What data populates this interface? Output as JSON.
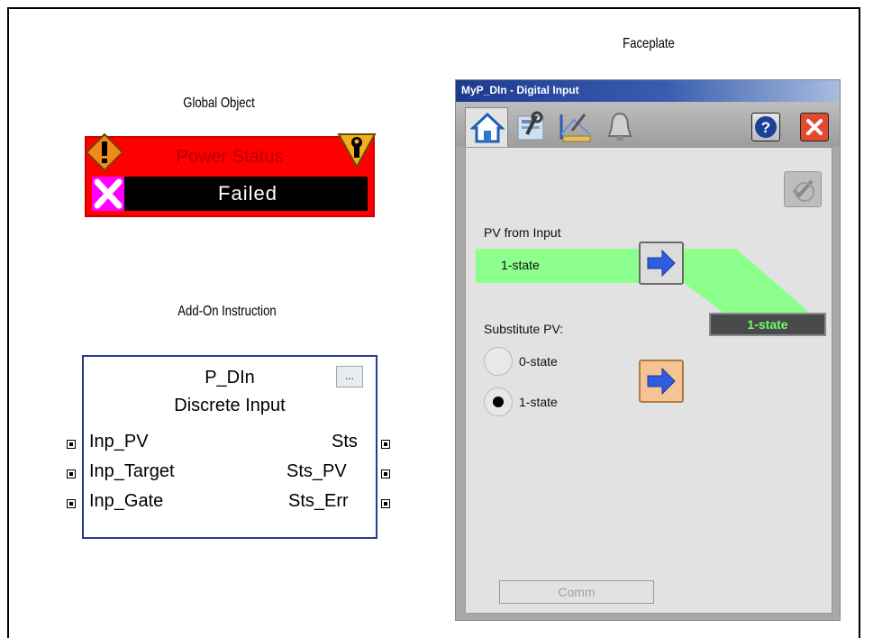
{
  "captions": {
    "faceplate": "Faceplate",
    "global_object": "Global Object",
    "add_on_instruction": "Add-On Instruction"
  },
  "global_object": {
    "title": "Power Status",
    "value": "Failed",
    "icons": [
      "warning-diamond-icon",
      "maintenance-wrench-icon",
      "failed-x-icon"
    ],
    "colors": {
      "alarm_red": "#ff0000",
      "value_bg": "#000000",
      "x_icon": "#ff00ff"
    }
  },
  "aoi": {
    "name": "P_DIn",
    "description": "Discrete Input",
    "button_label": "...",
    "inputs": [
      "Inp_PV",
      "Inp_Target",
      "Inp_Gate"
    ],
    "outputs": [
      "Sts",
      "Sts_PV",
      "Sts_Err"
    ]
  },
  "faceplate": {
    "title": "MyP_DIn - Digital Input",
    "tabs": [
      "home-icon",
      "settings-wrench-icon",
      "engineering-edit-icon",
      "alarm-bell-icon"
    ],
    "pv_from_input_label": "PV from Input",
    "pv_value": "1-state",
    "output_state": "1-state",
    "substitute_pv_label": "Substitute PV:",
    "options": [
      {
        "label": "0-state",
        "selected": false
      },
      {
        "label": "1-state",
        "selected": true
      }
    ],
    "comm_label": "Comm",
    "colors": {
      "pv_green": "#8dff8d",
      "state_text": "#6cff6c",
      "arrow_blue": "#2f5ce0"
    }
  }
}
